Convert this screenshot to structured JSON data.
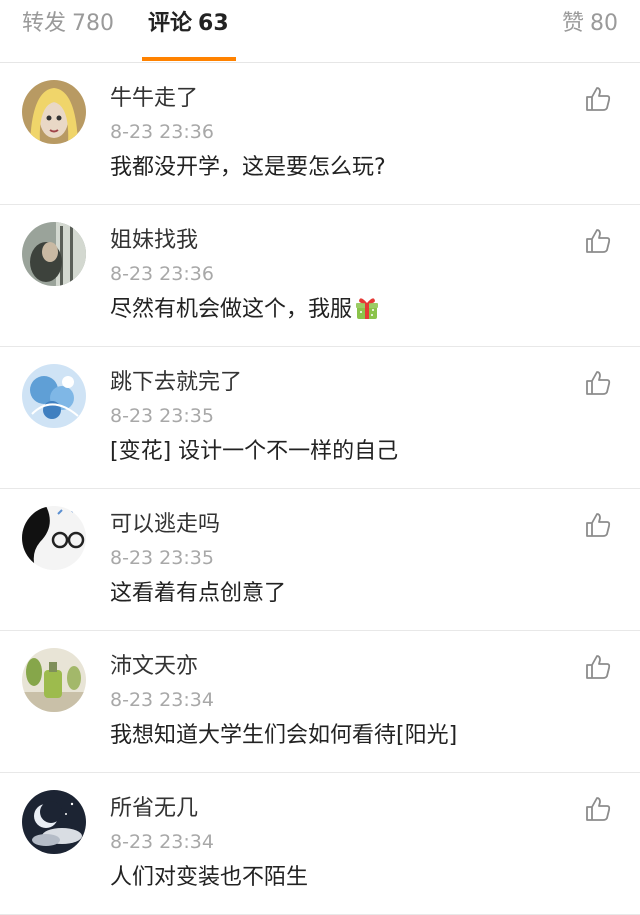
{
  "tabs": {
    "repost": {
      "label": "转发",
      "count": "780"
    },
    "comments": {
      "label": "评论",
      "count": "63"
    },
    "likes": {
      "label": "赞",
      "count": "80"
    }
  },
  "accent_color": "#ff8200",
  "icons": {
    "like": "thumbs-up-icon",
    "emoji": "gift-emoji-icon"
  },
  "comments": [
    {
      "name": "牛牛走了",
      "time": "8-23 23:36",
      "text": "我都没开学，这是要怎么玩?"
    },
    {
      "name": "姐妹找我",
      "time": "8-23 23:36",
      "text": "尽然有机会做这个，我服"
    },
    {
      "name": "跳下去就完了",
      "time": "8-23 23:35",
      "text": "[变花] 设计一个不一样的自己"
    },
    {
      "name": "可以逃走吗",
      "time": "8-23 23:35",
      "text": "这看着有点创意了"
    },
    {
      "name": "沛文天亦",
      "time": "8-23 23:34",
      "text": "我想知道大学生们会如何看待[阳光]"
    },
    {
      "name": "所省无几",
      "time": "8-23 23:34",
      "text": "人们对变装也不陌生"
    }
  ]
}
